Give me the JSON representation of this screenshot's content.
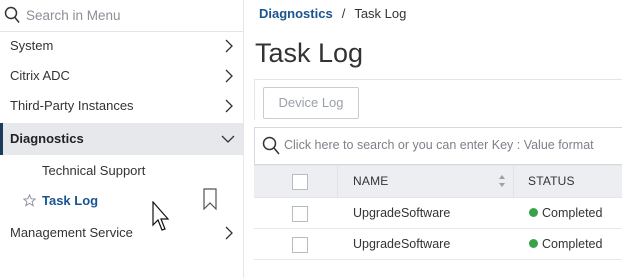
{
  "sidebar": {
    "search_placeholder": "Search in Menu",
    "items": [
      {
        "label": "System"
      },
      {
        "label": "Citrix ADC"
      },
      {
        "label": "Third-Party Instances"
      },
      {
        "label": "Diagnostics"
      },
      {
        "label": "Management Service"
      }
    ],
    "sub_items": [
      {
        "label": "Technical Support"
      },
      {
        "label": "Task Log"
      }
    ]
  },
  "breadcrumb": {
    "parent": "Diagnostics",
    "separator": "/",
    "current": "Task Log"
  },
  "page_title": "Task Log",
  "toolbar": {
    "device_log_label": "Device Log"
  },
  "table_search": {
    "placeholder": "Click here to search or you can enter Key : Value format"
  },
  "table": {
    "columns": [
      "NAME",
      "STATUS"
    ],
    "rows": [
      {
        "name": "UpgradeSoftware",
        "status": "Completed"
      },
      {
        "name": "UpgradeSoftware",
        "status": "Completed"
      }
    ]
  },
  "colors": {
    "accent": "#1a5490",
    "status_completed": "#3aa34a",
    "active_bg": "#e6e8ec"
  }
}
